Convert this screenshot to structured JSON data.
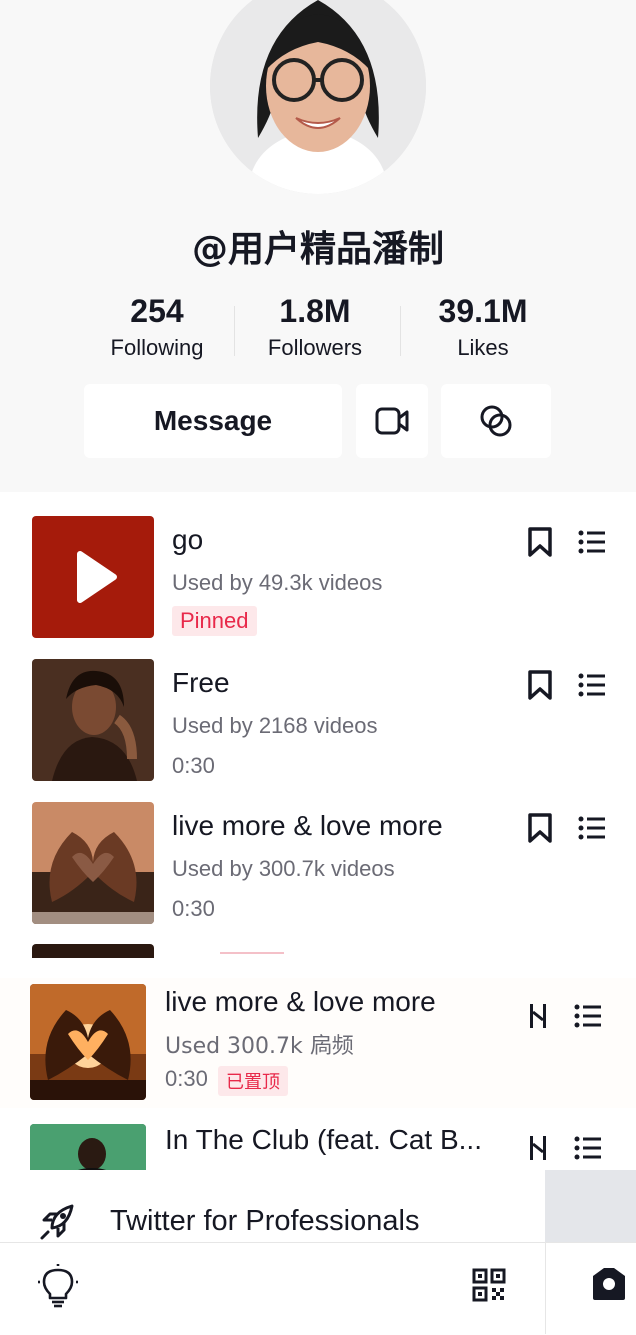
{
  "profile": {
    "username": "@用户精品潘制",
    "stats": [
      {
        "value": "254",
        "label": "Following"
      },
      {
        "value": "1.8M",
        "label": "Followers"
      },
      {
        "value": "39.1M",
        "label": "Likes"
      }
    ],
    "message_label": "Message"
  },
  "songs": [
    {
      "title": "go",
      "used": "Used by 49.3k videos",
      "badge": "Pinned"
    },
    {
      "title": "Free",
      "used": "Used by 2168 videos",
      "duration": "0:30"
    },
    {
      "title": "live more & love more",
      "used": "Used by 300.7k videos",
      "duration": "0:30"
    },
    {
      "title": "live more & love more",
      "used": "Used 300.7k 扄频",
      "duration": "0:30",
      "badge": "已置顶"
    },
    {
      "title": "In The Club (feat. Cat B..."
    }
  ],
  "pro_banner": {
    "label": "Twitter for Professionals"
  },
  "colors": {
    "accent": "#e8294a",
    "pinned_bg": "#fde8ea",
    "thumb_red": "#a51b0b"
  }
}
